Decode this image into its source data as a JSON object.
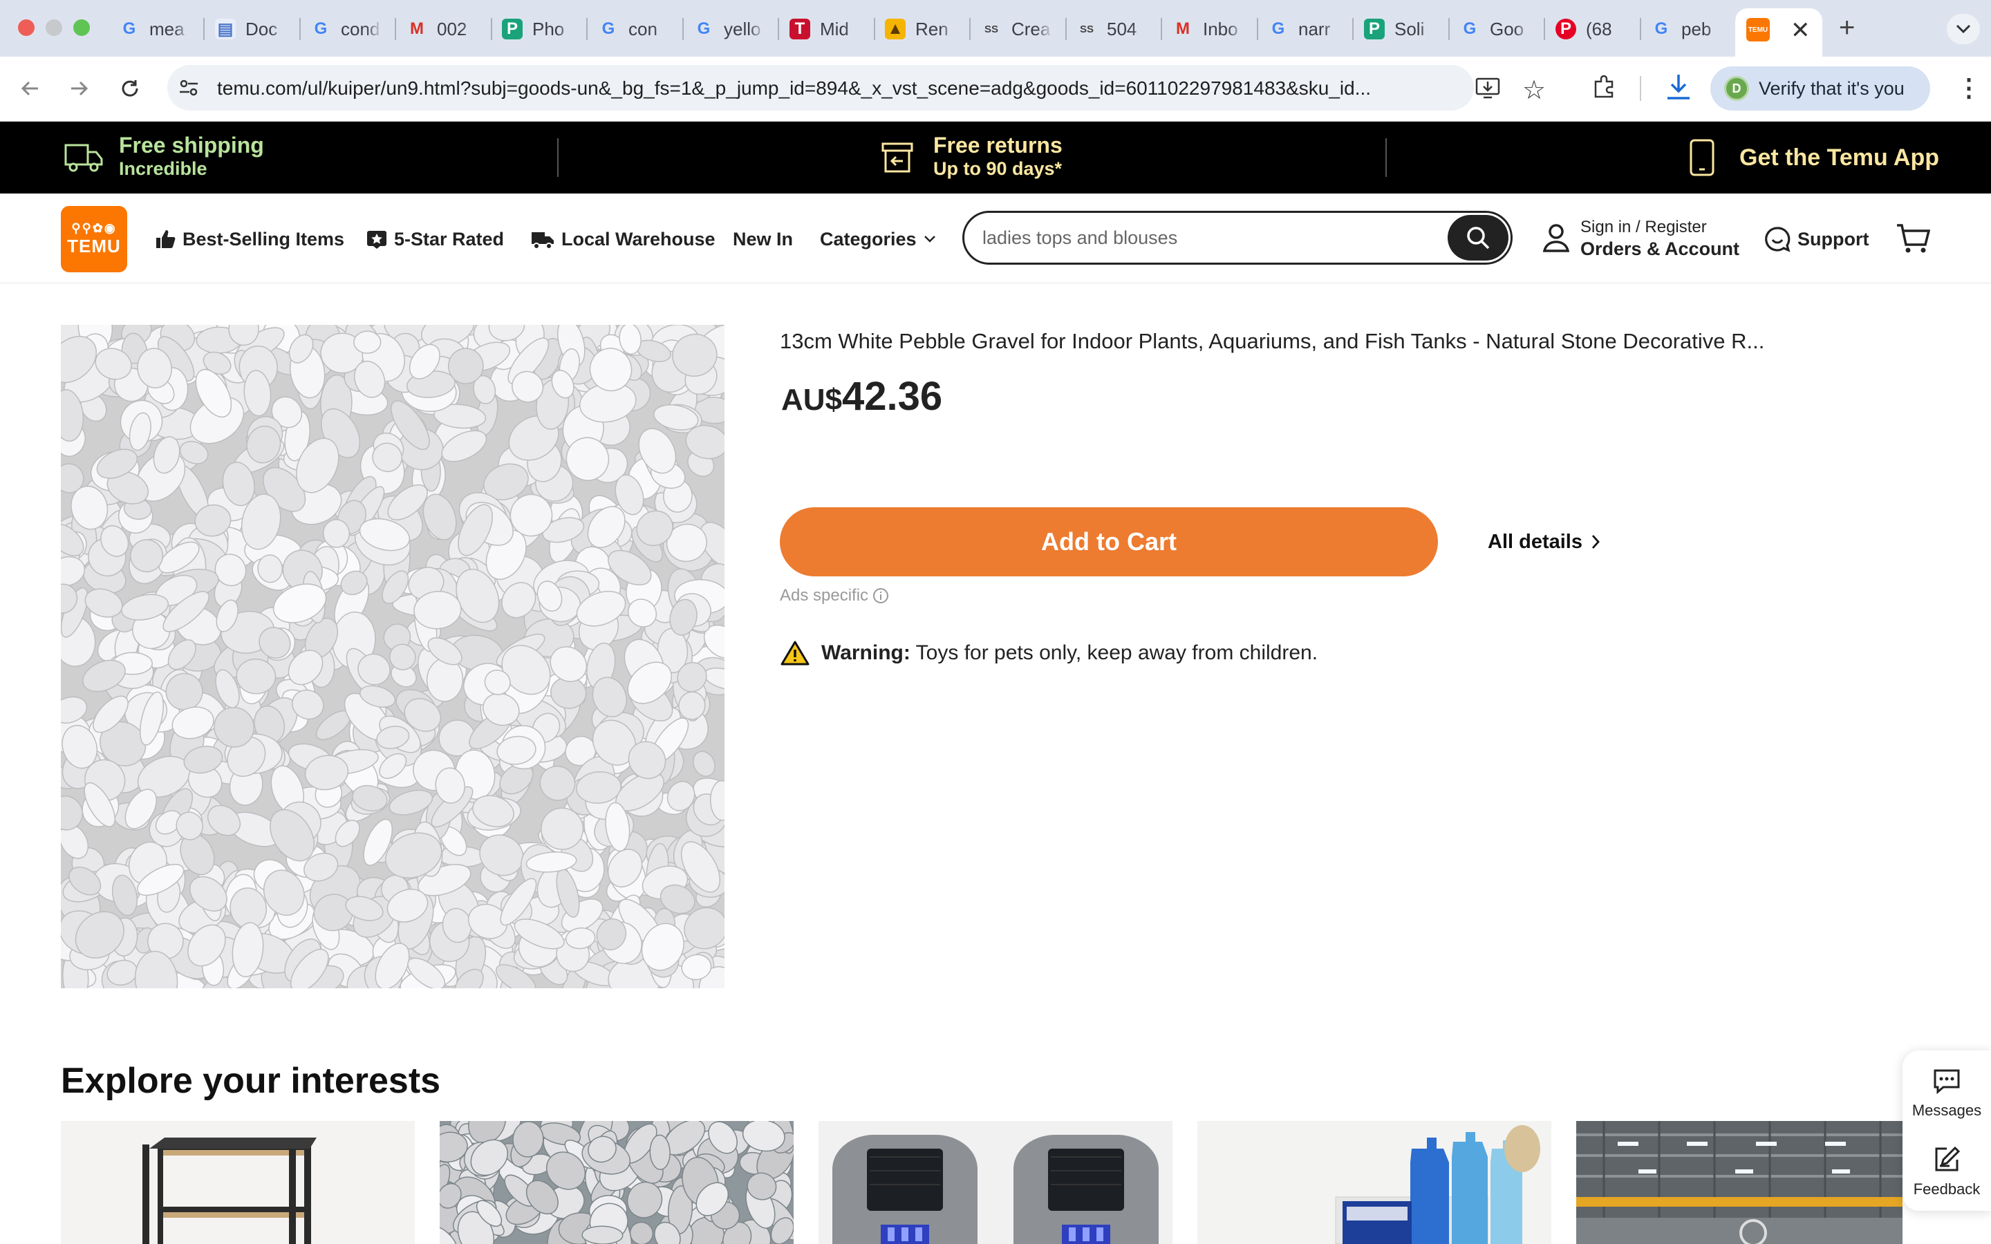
{
  "browser": {
    "tabs": [
      {
        "label": "mea",
        "icon": "google-icon"
      },
      {
        "label": "Doc",
        "icon": "document-icon"
      },
      {
        "label": "cond",
        "icon": "google-icon"
      },
      {
        "label": "002",
        "icon": "gmail-icon"
      },
      {
        "label": "Pho",
        "icon": "app-icon"
      },
      {
        "label": "con",
        "icon": "google-icon"
      },
      {
        "label": "yello",
        "icon": "google-icon"
      },
      {
        "label": "Mid",
        "icon": "t-icon"
      },
      {
        "label": "Ren",
        "icon": "graduation-icon"
      },
      {
        "label": "Crea",
        "icon": "ss-icon"
      },
      {
        "label": "504",
        "icon": "ss-icon"
      },
      {
        "label": "Inbo",
        "icon": "gmail-icon"
      },
      {
        "label": "narr",
        "icon": "google-icon"
      },
      {
        "label": "Soli",
        "icon": "app-icon"
      },
      {
        "label": "Goo",
        "icon": "google-icon"
      },
      {
        "label": "(68",
        "icon": "pinterest-icon"
      },
      {
        "label": "peb",
        "icon": "google-icon"
      }
    ],
    "active_tab_icon": "temu-icon",
    "url": "temu.com/ul/kuiper/un9.html?subj=goods-un&_bg_fs=1&_p_jump_id=894&_x_vst_scene=adg&goods_id=601102297981483&sku_id...",
    "profile_initial": "D",
    "verify_label": "Verify that it's you"
  },
  "promo": {
    "shipping_title": "Free shipping",
    "shipping_sub": "Incredible",
    "returns_title": "Free returns",
    "returns_sub": "Up to 90 days*",
    "app_label": "Get the Temu App"
  },
  "header": {
    "logo_text": "TEMU",
    "nav": {
      "best_selling": "Best-Selling Items",
      "five_star": "5-Star Rated",
      "local_warehouse": "Local Warehouse",
      "new_in": "New In",
      "categories": "Categories"
    },
    "search_value": "ladies tops and blouses",
    "sign_in": "Sign in / Register",
    "orders": "Orders & Account",
    "support": "Support"
  },
  "product": {
    "title": "13cm White Pebble Gravel for Indoor Plants, Aquariums, and Fish Tanks - Natural Stone Decorative R...",
    "currency": "AU$",
    "price": "42.36",
    "add_to_cart": "Add to Cart",
    "all_details": "All details",
    "ads_label": "Ads specific",
    "warning_label": "Warning:",
    "warning_text": "Toys for pets only, keep away from children."
  },
  "explore": {
    "title": "Explore your interests"
  },
  "side_widget": {
    "messages": "Messages",
    "feedback": "Feedback"
  },
  "colors": {
    "accent": "#fb7701",
    "cart_button": "#ed7b30",
    "promo_text": "#fbe7a1",
    "promo_bg": "#000000"
  }
}
